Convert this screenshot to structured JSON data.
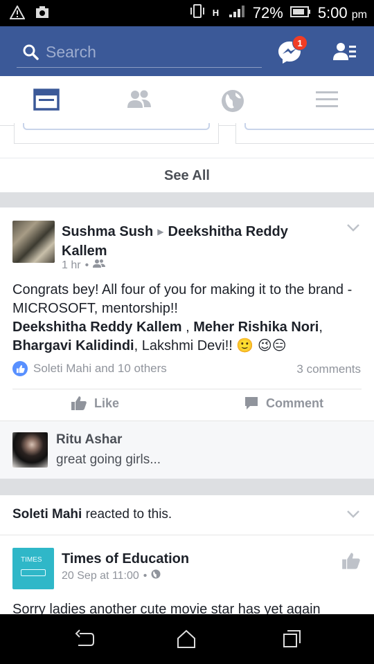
{
  "status_bar": {
    "battery": "72%",
    "time": "5:00",
    "ampm": "pm",
    "network": "H"
  },
  "search": {
    "placeholder": "Search"
  },
  "messenger": {
    "badge_count": "1"
  },
  "see_all": "See All",
  "post": {
    "author": "Sushma Sush",
    "target": "Deekshitha Reddy Kallem",
    "time": "1 hr",
    "text_plain": "Congrats bey! All four of you for making it to the brand -MICROSOFT, mentorship!!",
    "tag1": "Deekshitha Reddy Kallem",
    "sep1": " , ",
    "tag2": "Meher Rishika Nori",
    "sep2": ",",
    "tag3": "Bhargavi Kalidindi",
    "tail": ", Lakshmi Devi!! 🙂 😉😑",
    "likes_text": "Soleti Mahi and 10 others",
    "comments_text": "3 comments",
    "like_label": "Like",
    "comment_label": "Comment"
  },
  "comment": {
    "name": "Ritu Ashar",
    "text": "great going girls..."
  },
  "reaction": {
    "name": "Soleti Mahi",
    "text": " reacted to this."
  },
  "post2": {
    "author": "Times of Education",
    "time": "20 Sep at 11:00",
    "avatar_text": "TIMES",
    "text": "Sorry ladies another cute movie star has yet again"
  },
  "colors": {
    "brand": "#3b5998",
    "badge": "#f03d25",
    "like_blue": "#5890ff"
  }
}
